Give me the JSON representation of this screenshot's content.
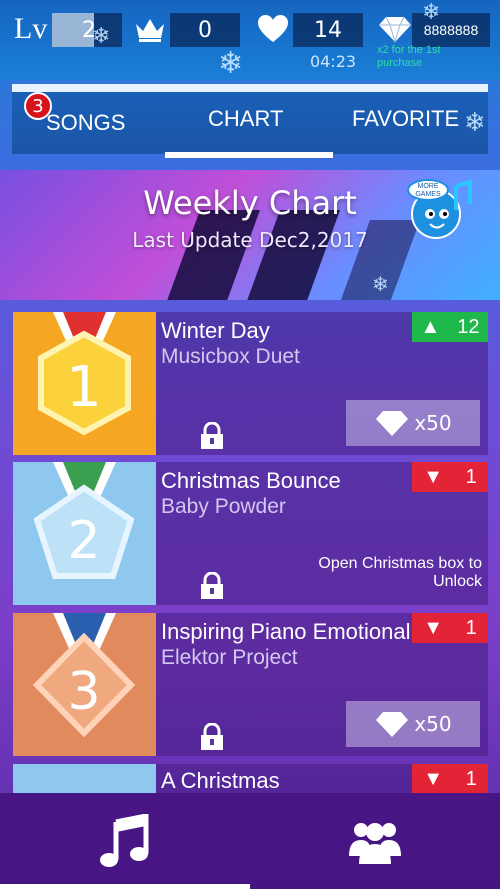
{
  "header": {
    "lv_label": "Lv",
    "level": "2",
    "crowns": "0",
    "lives": "14",
    "timer": "04:23",
    "gems": "8888888",
    "promo": "x2 for the 1st purchase"
  },
  "tabs": {
    "songs": "SONGS",
    "chart": "CHART",
    "favorite": "FAVORITE",
    "songs_badge": "3",
    "active": "CHART"
  },
  "banner": {
    "title": "Weekly Chart",
    "subtitle": "Last Update Dec2,2017",
    "more_games": "MORE GAMES"
  },
  "songs": [
    {
      "rank": "1",
      "title": "Winter Day",
      "artist": "Musicbox Duet",
      "change": "12",
      "trend": "up",
      "price": "x50",
      "medal_color": "#f5a623"
    },
    {
      "rank": "2",
      "title": "Christmas Bounce",
      "artist": "Baby Powder",
      "change": "1",
      "trend": "down",
      "unlock": "Open Christmas box to Unlock",
      "medal_color": "#8fc8ee"
    },
    {
      "rank": "3",
      "title": "Inspiring Piano Emotional",
      "artist": "Elektor Project",
      "change": "1",
      "trend": "down",
      "price": "x50",
      "medal_color": "#e08a5e"
    },
    {
      "title": "A Christmas",
      "change": "1",
      "trend": "down"
    }
  ],
  "bottom_nav": {
    "active": "music"
  }
}
